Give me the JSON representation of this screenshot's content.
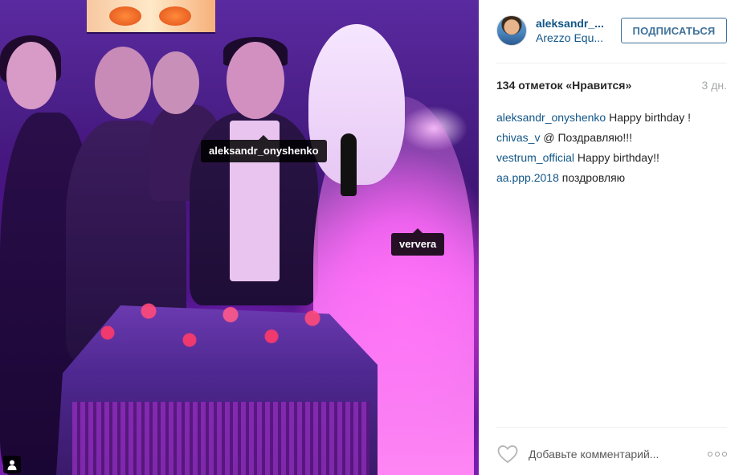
{
  "post": {
    "photo": {
      "tags": [
        {
          "label": "aleksandr_onyshenko"
        },
        {
          "label": "ververa"
        }
      ],
      "tagged_icon": "person-icon"
    },
    "header": {
      "username": "aleksandr_...",
      "location": "Arezzo Equ...",
      "follow_label": "ПОДПИСАТЬСЯ"
    },
    "stats": {
      "likes": "134 отметок «Нравится»",
      "time": "3 дн."
    },
    "comments": [
      {
        "user": "aleksandr_onyshenko",
        "text": "Happy birthday !"
      },
      {
        "user": "chivas_v",
        "text": "@ Поздравляю!!!"
      },
      {
        "user": "vestrum_official",
        "text": "Happy birthday!!"
      },
      {
        "user": "aa.ppp.2018",
        "text": "поздровляю"
      }
    ],
    "footer": {
      "comment_placeholder": "Добавьте комментарий...",
      "like_icon": "heart-icon",
      "more_icon": "more-options-icon"
    },
    "colors": {
      "link": "#125688",
      "button": "#3f729b",
      "muted": "#a5a7aa"
    }
  }
}
